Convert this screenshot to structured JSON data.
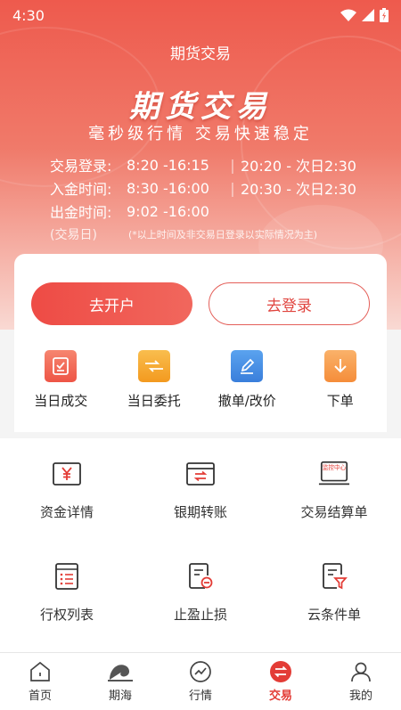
{
  "status_bar": {
    "time": "4:30"
  },
  "header": {
    "title": "期货交易"
  },
  "banner": {
    "title": "期货交易",
    "subtitle": "毫秒级行情 交易快速稳定",
    "rows": [
      {
        "label": "交易登录:",
        "t1": "8:20 -16:15",
        "t2": "20:20 - 次日2:30"
      },
      {
        "label": "入金时间:",
        "t1": "8:30 -16:00",
        "t2": "20:30 - 次日2:30"
      },
      {
        "label": "出金时间:",
        "t1": "9:02 -16:00",
        "t2": ""
      }
    ],
    "trading_day_label": "(交易日)",
    "note": "(*以上时间及非交易日登录以实际情况为主)"
  },
  "actions": {
    "open_account": "去开户",
    "login": "去登录"
  },
  "quick": [
    {
      "label": "当日成交",
      "icon": "check-doc-icon",
      "color": "#f26b5b"
    },
    {
      "label": "当日委托",
      "icon": "handshake-icon",
      "color": "#f5a623"
    },
    {
      "label": "撤单/改价",
      "icon": "edit-icon",
      "color": "#4a90e2"
    },
    {
      "label": "下单",
      "icon": "down-arrow-icon",
      "color": "#f7a04b"
    }
  ],
  "grid": [
    {
      "label": "资金详情",
      "icon": "yuan-doc-icon"
    },
    {
      "label": "银期转账",
      "icon": "transfer-icon"
    },
    {
      "label": "交易结算单",
      "icon": "monitor-center-icon",
      "badge": "监控中心"
    },
    {
      "label": "行权列表",
      "icon": "list-icon"
    },
    {
      "label": "止盈止损",
      "icon": "stop-doc-icon"
    },
    {
      "label": "云条件单",
      "icon": "filter-doc-icon"
    }
  ],
  "nav": [
    {
      "label": "首页",
      "icon": "home-icon"
    },
    {
      "label": "期海",
      "icon": "snail-icon"
    },
    {
      "label": "行情",
      "icon": "chart-circle-icon"
    },
    {
      "label": "交易",
      "icon": "exchange-icon",
      "active": true
    },
    {
      "label": "我的",
      "icon": "person-icon"
    }
  ],
  "colors": {
    "accent": "#e33c36"
  }
}
